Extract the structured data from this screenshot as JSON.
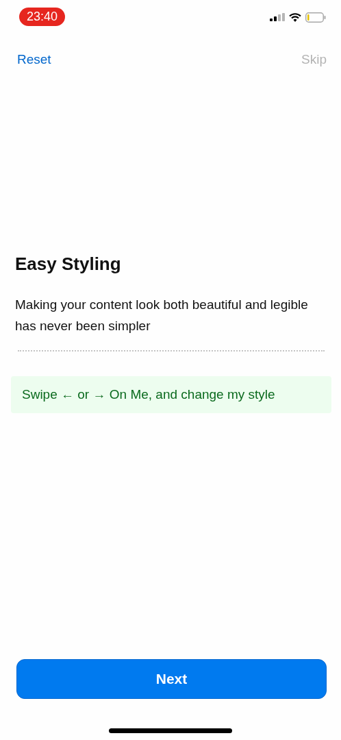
{
  "status_bar": {
    "time": "23:40"
  },
  "nav": {
    "left": {
      "label": "Reset",
      "disabled": false
    },
    "right": {
      "label": "Skip",
      "disabled": true
    }
  },
  "title": "Easy Styling",
  "description": "Making your content look both beautiful and legible has never been simpler",
  "hint": "Swipe ← or → On Me, and change my style",
  "primary_button": {
    "label": "Next"
  }
}
